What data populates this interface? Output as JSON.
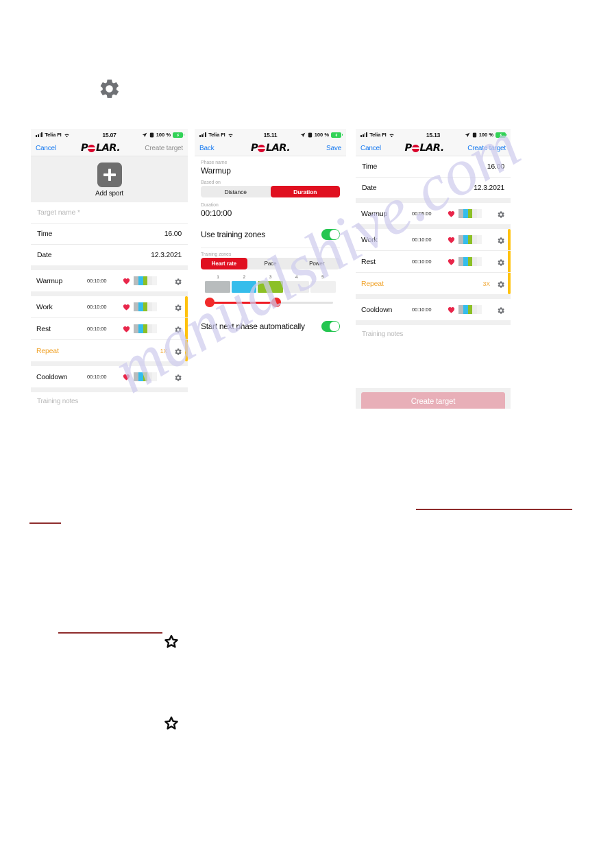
{
  "page": {
    "top_icon": "gear-icon",
    "decor_star_icon": "star-outline-icon"
  },
  "colors": {
    "polar_red": "#d9042b",
    "ios_blue": "#1478f0",
    "accent_red": "#e01020",
    "toggle_green": "#25c651",
    "repeat_amber": "#f0a32a",
    "bracket_yellow": "#ffc20e",
    "zone1_gray": "#b8bcbd",
    "zone2_cyan": "#35bdeb",
    "zone3_green": "#8cc026",
    "zone_inactive": "#ececec",
    "create_btn_disabled": "#e8afb8",
    "rule_red": "#8e2c2c"
  },
  "watermark": {
    "text": "manualshive.com"
  },
  "screen1": {
    "statusbar": {
      "carrier": "Telia FI",
      "time": "15.07",
      "battery": "100 %",
      "signal_icon": "signal-bars-icon",
      "wifi_icon": "wifi-icon",
      "location_icon": "location-arrow-icon",
      "alarm_icon": "alarm-icon",
      "battery_icon": "battery-charging-icon"
    },
    "nav": {
      "left": "Cancel",
      "logo": "POLAR",
      "right": "Create target"
    },
    "add_sport": {
      "icon": "plus-icon",
      "label": "Add sport"
    },
    "fields": [
      {
        "label": "Target name *",
        "value": "",
        "placeholder": true
      },
      {
        "label": "Time",
        "value": "16.00"
      },
      {
        "label": "Date",
        "value": "12.3.2021"
      }
    ],
    "phases_top": [
      {
        "name": "Warmup",
        "duration": "00:10:00",
        "heart": true,
        "zones": [
          1,
          2,
          3
        ],
        "gear": "gear-icon"
      }
    ],
    "phases_repeat": [
      {
        "name": "Work",
        "duration": "00:10:00",
        "heart": true,
        "zones": [
          1,
          2,
          3
        ],
        "gear": "gear-icon"
      },
      {
        "name": "Rest",
        "duration": "00:10:00",
        "heart": true,
        "zones": [
          1,
          2,
          3
        ],
        "gear": "gear-icon"
      }
    ],
    "repeat_row": {
      "name": "Repeat",
      "count": "1X",
      "gear": "gear-icon"
    },
    "phases_bottom": [
      {
        "name": "Cooldown",
        "duration": "00:10:00",
        "heart": true,
        "zones": [
          1,
          2,
          3
        ],
        "gear": "gear-icon"
      }
    ],
    "notes_placeholder": "Training notes"
  },
  "screen2": {
    "statusbar": {
      "carrier": "Telia FI",
      "time": "15.11",
      "battery": "100 %"
    },
    "nav": {
      "left": "Back",
      "logo": "POLAR",
      "right": "Save"
    },
    "phase_name_label": "Phase name",
    "phase_name_value": "Warmup",
    "based_on_label": "Based on",
    "based_on_options": [
      "Distance",
      "Duration"
    ],
    "based_on_selected": "Duration",
    "duration_label": "Duration",
    "duration_value": "00:10:00",
    "use_training_zones_label": "Use training zones",
    "use_training_zones_on": true,
    "training_zones_label": "Training zones",
    "zone_type_options": [
      "Heart rate",
      "Pace",
      "Power"
    ],
    "zone_type_selected": "Heart rate",
    "zone_numbers": [
      "1",
      "2",
      "3",
      "4",
      "5"
    ],
    "zone_selected_from": 1,
    "zone_selected_to": 3,
    "start_next_label": "Start next phase automatically",
    "start_next_on": true
  },
  "screen3": {
    "statusbar": {
      "carrier": "Telia FI",
      "time": "15.13",
      "battery": "100 %"
    },
    "nav": {
      "left": "Cancel",
      "logo": "POLAR",
      "right": "Create target"
    },
    "fields": [
      {
        "label": "Time",
        "value": "16.00"
      },
      {
        "label": "Date",
        "value": "12.3.2021"
      }
    ],
    "phases_top": [
      {
        "name": "Warmup",
        "duration": "00:05:00",
        "heart": true,
        "zones": [
          1,
          2,
          3
        ],
        "gear": "gear-icon"
      }
    ],
    "phases_repeat": [
      {
        "name": "Work",
        "duration": "00:10:00",
        "heart": true,
        "zones": [
          1,
          2,
          3
        ],
        "gear": "gear-icon"
      },
      {
        "name": "Rest",
        "duration": "00:10:00",
        "heart": true,
        "zones": [
          1,
          2,
          3
        ],
        "gear": "gear-icon"
      }
    ],
    "repeat_row": {
      "name": "Repeat",
      "count": "3X",
      "gear": "gear-icon"
    },
    "phases_bottom": [
      {
        "name": "Cooldown",
        "duration": "00:10:00",
        "heart": true,
        "zones": [
          1,
          2,
          3
        ],
        "gear": "gear-icon"
      }
    ],
    "notes_placeholder": "Training notes",
    "create_button": "Create target"
  }
}
